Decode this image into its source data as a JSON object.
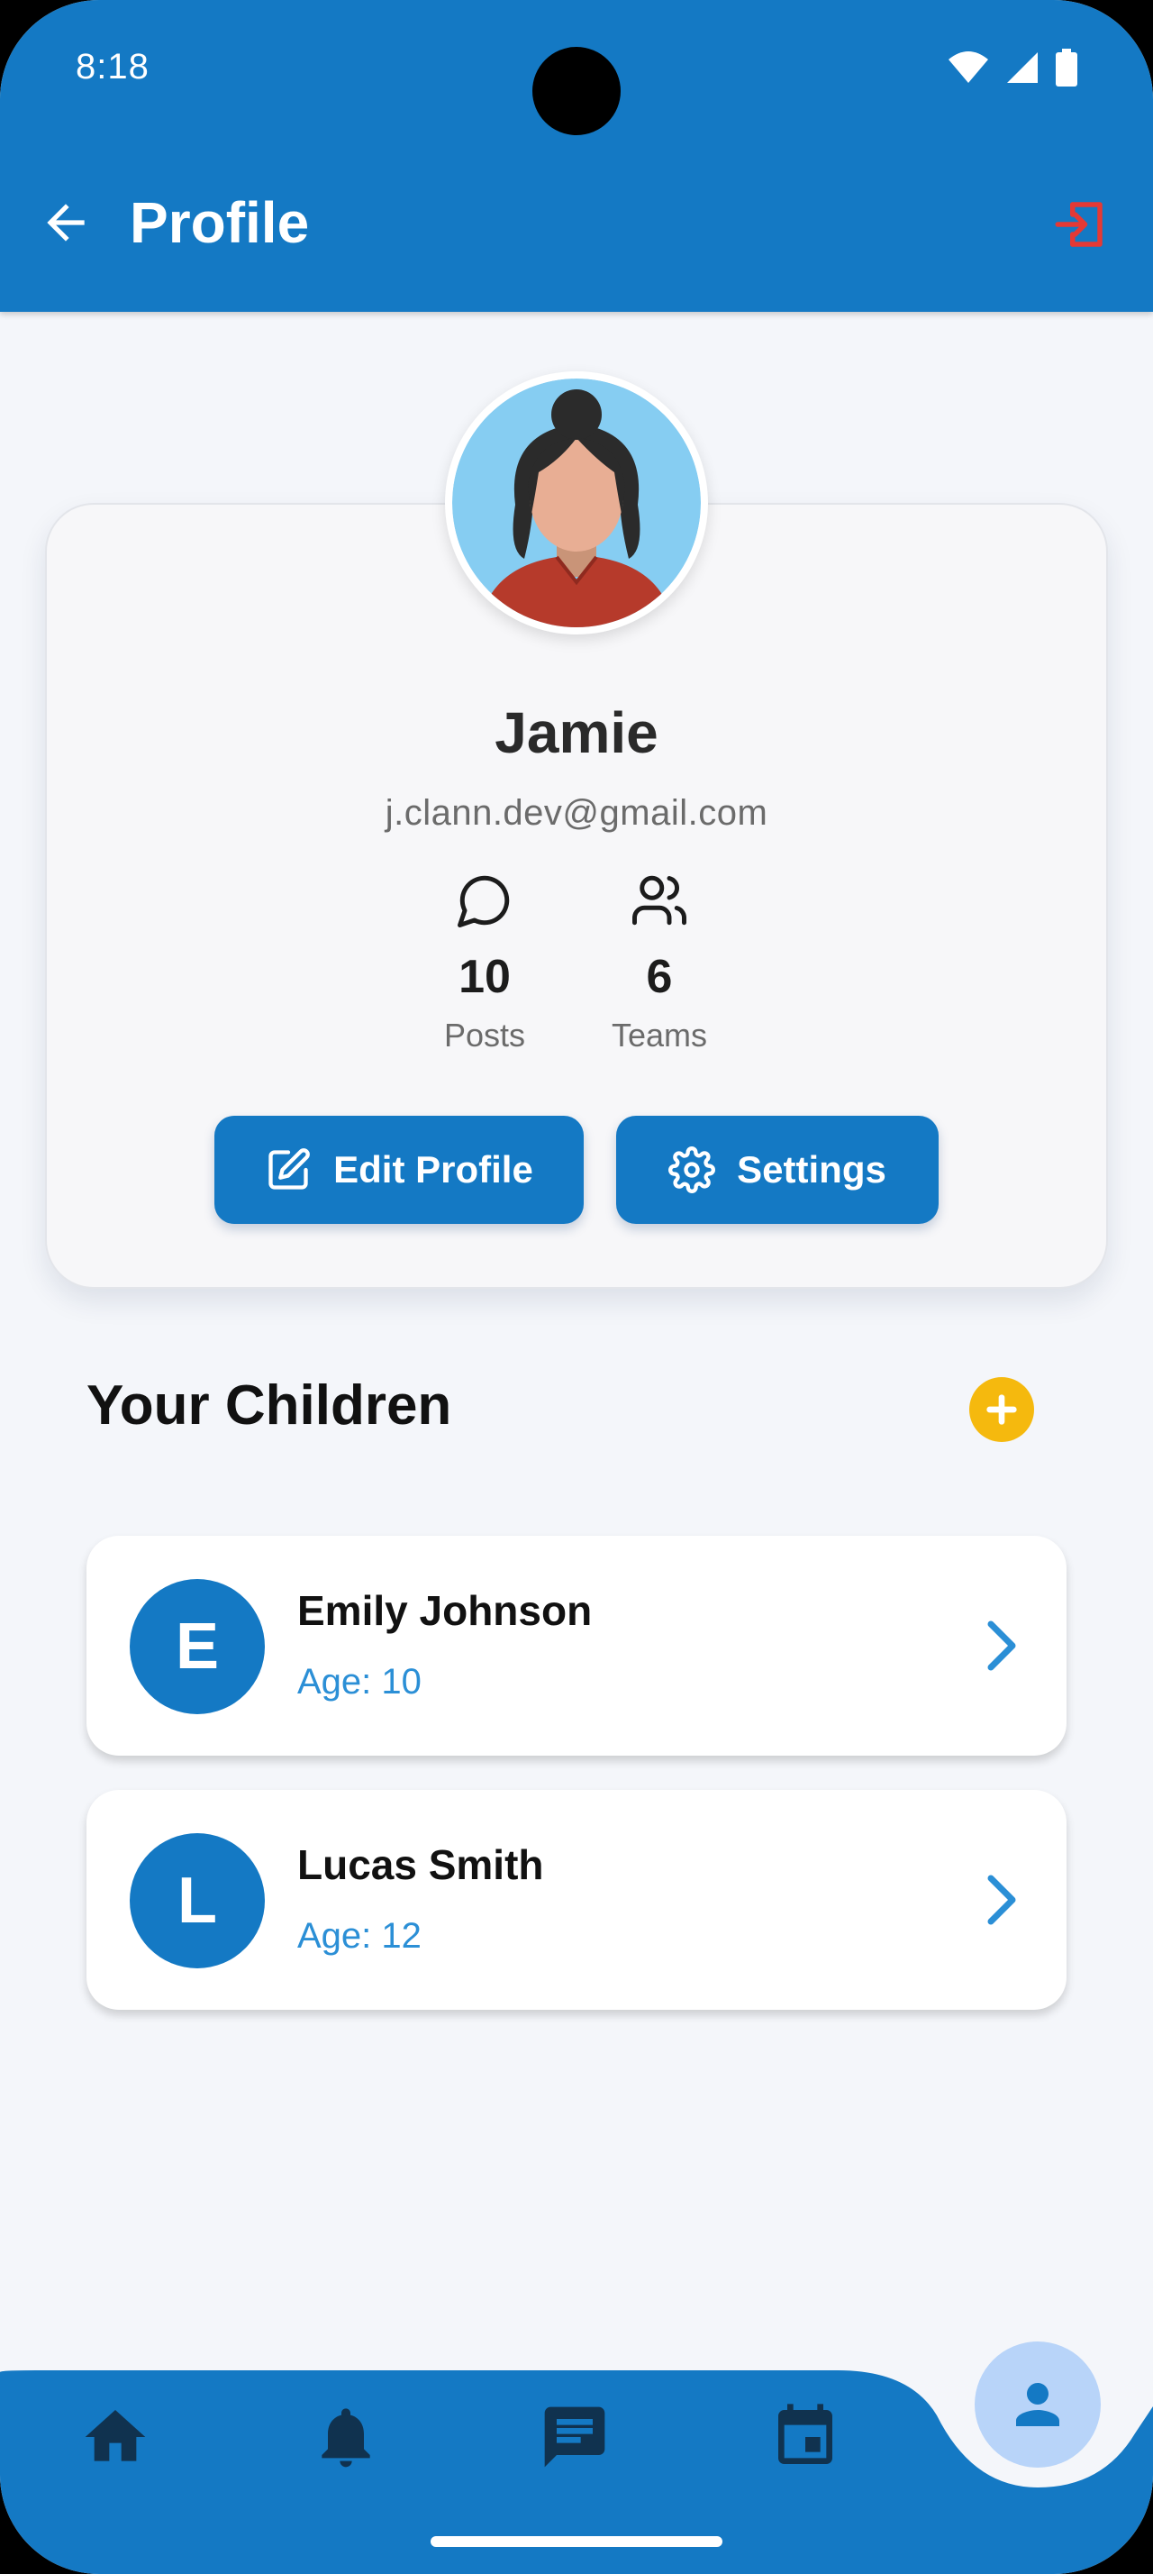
{
  "status_bar": {
    "time": "8:18"
  },
  "app_bar": {
    "title": "Profile"
  },
  "profile": {
    "name": "Jamie",
    "email": "j.clann.dev@gmail.com",
    "stats": [
      {
        "value": "10",
        "label": "Posts",
        "icon": "chat-bubble-icon"
      },
      {
        "value": "6",
        "label": "Teams",
        "icon": "users-icon"
      }
    ],
    "edit_label": "Edit Profile",
    "settings_label": "Settings"
  },
  "children": {
    "title": "Your Children",
    "items": [
      {
        "initial": "E",
        "name": "Emily Johnson",
        "age": "Age: 10"
      },
      {
        "initial": "L",
        "name": "Lucas Smith",
        "age": "Age: 12"
      }
    ]
  },
  "bottom_nav": {
    "items": [
      "home-icon",
      "bell-icon",
      "message-icon",
      "calendar-icon",
      "profile-icon"
    ],
    "active": "profile-icon"
  },
  "colors": {
    "primary": "#1479c4",
    "accent_yellow": "#f5b90e",
    "logout_red": "#e53935",
    "age_blue": "#2b8fd6",
    "fab_light": "#b8d4f9"
  }
}
